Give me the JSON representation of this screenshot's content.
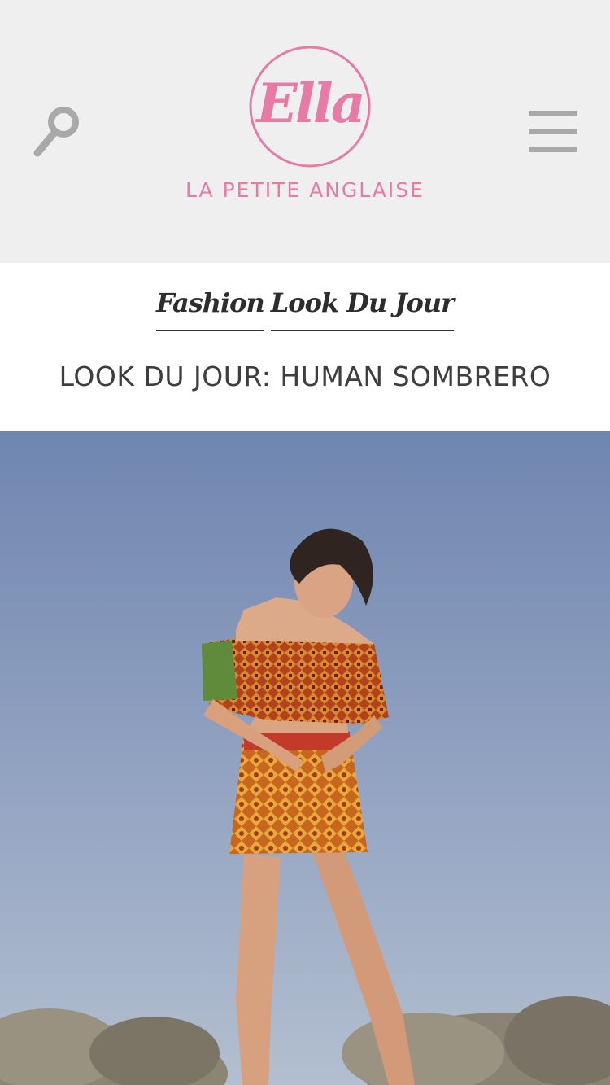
{
  "header": {
    "logo": {
      "wordmark": "Ella",
      "tagline": "LA PETITE ANGLAISE"
    },
    "search_icon": "search-icon",
    "menu_icon": "hamburger-menu-icon"
  },
  "post": {
    "categories": [
      {
        "label": "Fashion"
      },
      {
        "label": "Look Du Jour"
      }
    ],
    "title": "LOOK DU JOUR: HUMAN SOMBRERO"
  },
  "colors": {
    "brand_pink": "#e87aa6",
    "header_bg": "#efefef",
    "title_text": "#3e3e3e",
    "sky_top": "#6f86b0",
    "sky_bottom": "#b3bfd0"
  },
  "hero_image": {
    "description_icon": "photo"
  }
}
